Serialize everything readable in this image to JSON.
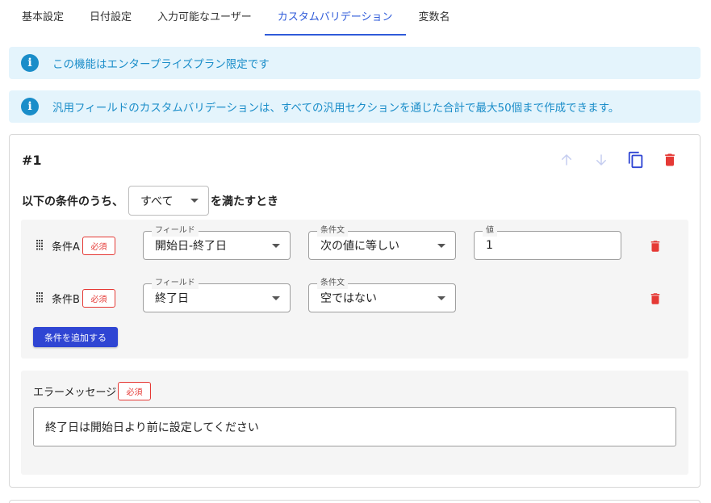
{
  "tabs": [
    {
      "label": "基本設定",
      "active": false
    },
    {
      "label": "日付設定",
      "active": false
    },
    {
      "label": "入力可能なユーザー",
      "active": false
    },
    {
      "label": "カスタムバリデーション",
      "active": true
    },
    {
      "label": "変数名",
      "active": false
    }
  ],
  "alerts": [
    {
      "text": "この機能はエンタープライズプラン限定です",
      "icon": "info-icon"
    },
    {
      "text": "汎用フィールドのカスタムバリデーションは、すべての汎用セクションを通じた合計で最大50個まで作成できます。",
      "icon": "info-icon"
    }
  ],
  "rule": {
    "title": "#1",
    "condition_prefix": "以下の条件のうち、",
    "match_mode": "すべて",
    "condition_suffix": "を満たすとき",
    "conditions": [
      {
        "label": "条件A",
        "required": "必須",
        "field_legend": "フィールド",
        "field_value": "開始日-終了日",
        "cond_legend": "条件文",
        "cond_value": "次の値に等しい",
        "value_legend": "値",
        "value": "1"
      },
      {
        "label": "条件B",
        "required": "必須",
        "field_legend": "フィールド",
        "field_value": "終了日",
        "cond_legend": "条件文",
        "cond_value": "空ではない"
      }
    ],
    "add_condition_label": "条件を追加する",
    "error_label": "エラーメッセージ",
    "error_required": "必須",
    "error_message": "終了日は開始日より前に設定してください"
  },
  "colors": {
    "accent": "#2f5bd9",
    "info": "#1a8dc9",
    "info_bg": "#e4f4fc",
    "danger": "#e53935",
    "button": "#2f45d3"
  }
}
